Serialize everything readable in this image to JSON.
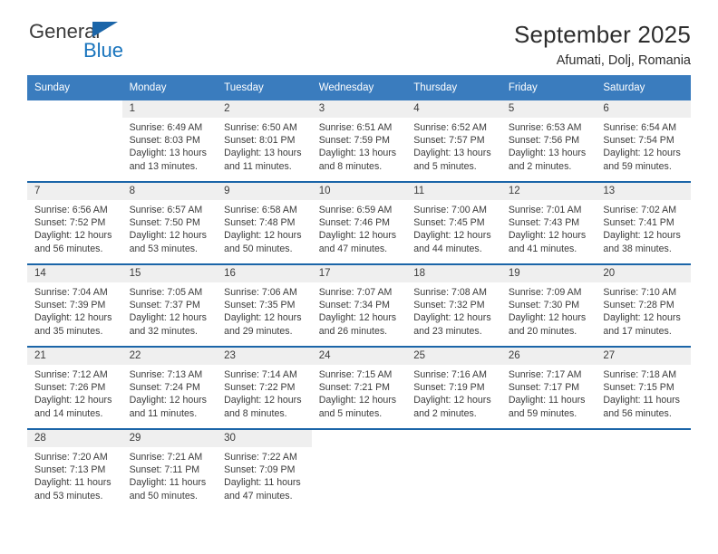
{
  "logo": {
    "word1": "General",
    "word2": "Blue",
    "triangle_color": "#1b65a8",
    "word1_color": "#3b3b3b",
    "word2_color": "#1874bd"
  },
  "header": {
    "title": "September 2025",
    "subtitle": "Afumati, Dolj, Romania"
  },
  "theme": {
    "header_bg": "#3a7cbe",
    "week_separator": "#1b65a8",
    "daynum_bg": "#efefef",
    "text": "#3b3b3b"
  },
  "calendar": {
    "weekday_headers": [
      "Sunday",
      "Monday",
      "Tuesday",
      "Wednesday",
      "Thursday",
      "Friday",
      "Saturday"
    ],
    "weeks": [
      [
        {
          "day": "",
          "lines": []
        },
        {
          "day": "1",
          "lines": [
            "Sunrise: 6:49 AM",
            "Sunset: 8:03 PM",
            "Daylight: 13 hours",
            "and 13 minutes."
          ]
        },
        {
          "day": "2",
          "lines": [
            "Sunrise: 6:50 AM",
            "Sunset: 8:01 PM",
            "Daylight: 13 hours",
            "and 11 minutes."
          ]
        },
        {
          "day": "3",
          "lines": [
            "Sunrise: 6:51 AM",
            "Sunset: 7:59 PM",
            "Daylight: 13 hours",
            "and 8 minutes."
          ]
        },
        {
          "day": "4",
          "lines": [
            "Sunrise: 6:52 AM",
            "Sunset: 7:57 PM",
            "Daylight: 13 hours",
            "and 5 minutes."
          ]
        },
        {
          "day": "5",
          "lines": [
            "Sunrise: 6:53 AM",
            "Sunset: 7:56 PM",
            "Daylight: 13 hours",
            "and 2 minutes."
          ]
        },
        {
          "day": "6",
          "lines": [
            "Sunrise: 6:54 AM",
            "Sunset: 7:54 PM",
            "Daylight: 12 hours",
            "and 59 minutes."
          ]
        }
      ],
      [
        {
          "day": "7",
          "lines": [
            "Sunrise: 6:56 AM",
            "Sunset: 7:52 PM",
            "Daylight: 12 hours",
            "and 56 minutes."
          ]
        },
        {
          "day": "8",
          "lines": [
            "Sunrise: 6:57 AM",
            "Sunset: 7:50 PM",
            "Daylight: 12 hours",
            "and 53 minutes."
          ]
        },
        {
          "day": "9",
          "lines": [
            "Sunrise: 6:58 AM",
            "Sunset: 7:48 PM",
            "Daylight: 12 hours",
            "and 50 minutes."
          ]
        },
        {
          "day": "10",
          "lines": [
            "Sunrise: 6:59 AM",
            "Sunset: 7:46 PM",
            "Daylight: 12 hours",
            "and 47 minutes."
          ]
        },
        {
          "day": "11",
          "lines": [
            "Sunrise: 7:00 AM",
            "Sunset: 7:45 PM",
            "Daylight: 12 hours",
            "and 44 minutes."
          ]
        },
        {
          "day": "12",
          "lines": [
            "Sunrise: 7:01 AM",
            "Sunset: 7:43 PM",
            "Daylight: 12 hours",
            "and 41 minutes."
          ]
        },
        {
          "day": "13",
          "lines": [
            "Sunrise: 7:02 AM",
            "Sunset: 7:41 PM",
            "Daylight: 12 hours",
            "and 38 minutes."
          ]
        }
      ],
      [
        {
          "day": "14",
          "lines": [
            "Sunrise: 7:04 AM",
            "Sunset: 7:39 PM",
            "Daylight: 12 hours",
            "and 35 minutes."
          ]
        },
        {
          "day": "15",
          "lines": [
            "Sunrise: 7:05 AM",
            "Sunset: 7:37 PM",
            "Daylight: 12 hours",
            "and 32 minutes."
          ]
        },
        {
          "day": "16",
          "lines": [
            "Sunrise: 7:06 AM",
            "Sunset: 7:35 PM",
            "Daylight: 12 hours",
            "and 29 minutes."
          ]
        },
        {
          "day": "17",
          "lines": [
            "Sunrise: 7:07 AM",
            "Sunset: 7:34 PM",
            "Daylight: 12 hours",
            "and 26 minutes."
          ]
        },
        {
          "day": "18",
          "lines": [
            "Sunrise: 7:08 AM",
            "Sunset: 7:32 PM",
            "Daylight: 12 hours",
            "and 23 minutes."
          ]
        },
        {
          "day": "19",
          "lines": [
            "Sunrise: 7:09 AM",
            "Sunset: 7:30 PM",
            "Daylight: 12 hours",
            "and 20 minutes."
          ]
        },
        {
          "day": "20",
          "lines": [
            "Sunrise: 7:10 AM",
            "Sunset: 7:28 PM",
            "Daylight: 12 hours",
            "and 17 minutes."
          ]
        }
      ],
      [
        {
          "day": "21",
          "lines": [
            "Sunrise: 7:12 AM",
            "Sunset: 7:26 PM",
            "Daylight: 12 hours",
            "and 14 minutes."
          ]
        },
        {
          "day": "22",
          "lines": [
            "Sunrise: 7:13 AM",
            "Sunset: 7:24 PM",
            "Daylight: 12 hours",
            "and 11 minutes."
          ]
        },
        {
          "day": "23",
          "lines": [
            "Sunrise: 7:14 AM",
            "Sunset: 7:22 PM",
            "Daylight: 12 hours",
            "and 8 minutes."
          ]
        },
        {
          "day": "24",
          "lines": [
            "Sunrise: 7:15 AM",
            "Sunset: 7:21 PM",
            "Daylight: 12 hours",
            "and 5 minutes."
          ]
        },
        {
          "day": "25",
          "lines": [
            "Sunrise: 7:16 AM",
            "Sunset: 7:19 PM",
            "Daylight: 12 hours",
            "and 2 minutes."
          ]
        },
        {
          "day": "26",
          "lines": [
            "Sunrise: 7:17 AM",
            "Sunset: 7:17 PM",
            "Daylight: 11 hours",
            "and 59 minutes."
          ]
        },
        {
          "day": "27",
          "lines": [
            "Sunrise: 7:18 AM",
            "Sunset: 7:15 PM",
            "Daylight: 11 hours",
            "and 56 minutes."
          ]
        }
      ],
      [
        {
          "day": "28",
          "lines": [
            "Sunrise: 7:20 AM",
            "Sunset: 7:13 PM",
            "Daylight: 11 hours",
            "and 53 minutes."
          ]
        },
        {
          "day": "29",
          "lines": [
            "Sunrise: 7:21 AM",
            "Sunset: 7:11 PM",
            "Daylight: 11 hours",
            "and 50 minutes."
          ]
        },
        {
          "day": "30",
          "lines": [
            "Sunrise: 7:22 AM",
            "Sunset: 7:09 PM",
            "Daylight: 11 hours",
            "and 47 minutes."
          ]
        },
        {
          "day": "",
          "lines": []
        },
        {
          "day": "",
          "lines": []
        },
        {
          "day": "",
          "lines": []
        },
        {
          "day": "",
          "lines": []
        }
      ]
    ]
  }
}
